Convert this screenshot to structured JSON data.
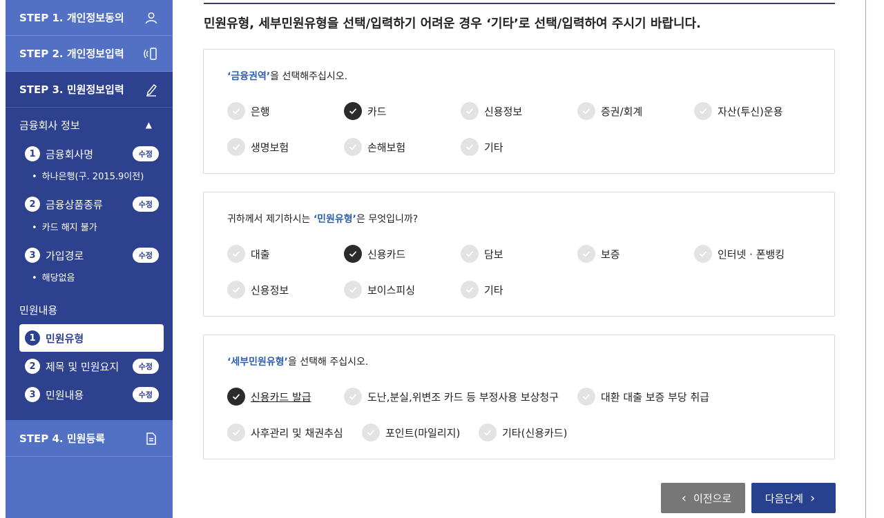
{
  "sidebar": {
    "steps": [
      {
        "label": "STEP 1. 개인정보동의",
        "icon": "person-icon"
      },
      {
        "label": "STEP 2. 개인정보입력",
        "icon": "phone-icon"
      },
      {
        "label": "STEP 3. 민원정보입력",
        "icon": "pencil-icon"
      },
      {
        "label": "STEP 4. 민원등록",
        "icon": "document-icon"
      }
    ],
    "financial_section": {
      "title": "금융회사 정보",
      "items": [
        {
          "num": "1",
          "label": "금융회사명",
          "edit": "수정",
          "value": "하나은행(구. 2015.9이전)"
        },
        {
          "num": "2",
          "label": "금융상품종류",
          "edit": "수정",
          "value": "카드 해지 불가"
        },
        {
          "num": "3",
          "label": "가입경로",
          "edit": "수정",
          "value": "해당없음"
        }
      ]
    },
    "complaint_section": {
      "title": "민원내용",
      "items": [
        {
          "num": "1",
          "label": "민원유형"
        },
        {
          "num": "2",
          "label": "제목 및 민원요지",
          "edit": "수정"
        },
        {
          "num": "3",
          "label": "민원내용",
          "edit": "수정"
        }
      ]
    }
  },
  "main": {
    "headline": "민원유형, 세부민원유형을 선택/입력하기 어려운 경우 ‘기타’로 선택/입력하여 주시기 바랍니다.",
    "panels": [
      {
        "q_pre": "",
        "q_hl": "‘금융권역’",
        "q_post": "을 선택해주십시오.",
        "options": [
          {
            "label": "은행",
            "checked": false
          },
          {
            "label": "카드",
            "checked": true
          },
          {
            "label": "신용정보",
            "checked": false
          },
          {
            "label": "증권/회계",
            "checked": false
          },
          {
            "label": "자산(투신)운용",
            "checked": false
          },
          {
            "label": "생명보험",
            "checked": false
          },
          {
            "label": "손해보험",
            "checked": false
          },
          {
            "label": "기타",
            "checked": false
          }
        ]
      },
      {
        "q_pre": "귀하께서 제기하시는 ",
        "q_hl": "‘민원유형’",
        "q_post": "은 무엇입니까?",
        "options": [
          {
            "label": "대출",
            "checked": false
          },
          {
            "label": "신용카드",
            "checked": true
          },
          {
            "label": "담보",
            "checked": false
          },
          {
            "label": "보증",
            "checked": false
          },
          {
            "label": "인터넷 · 폰뱅킹",
            "checked": false
          },
          {
            "label": "신용정보",
            "checked": false
          },
          {
            "label": "보이스피싱",
            "checked": false
          },
          {
            "label": "기타",
            "checked": false
          }
        ]
      },
      {
        "q_pre": "",
        "q_hl": "‘세부민원유형’",
        "q_post": "을 선택해 주십시오.",
        "options": [
          {
            "label": "신용카드 발급",
            "checked": true
          },
          {
            "label": "도난,분실,위변조 카드 등 부정사용 보상청구",
            "checked": false
          },
          {
            "label": "대환 대출 보증 부당 취급",
            "checked": false
          },
          {
            "label": "사후관리 및 채권추심",
            "checked": false
          },
          {
            "label": "포인트(마일리지)",
            "checked": false
          },
          {
            "label": "기타(신용카드)",
            "checked": false
          }
        ]
      }
    ],
    "buttons": {
      "prev": "이전으로",
      "next": "다음단계"
    }
  },
  "colors": {
    "sidebar": "#5270c4",
    "sidebar_active": "#2e418f",
    "highlight_text": "#2e5fae",
    "next_button": "#27418f",
    "prev_button": "#777777"
  }
}
